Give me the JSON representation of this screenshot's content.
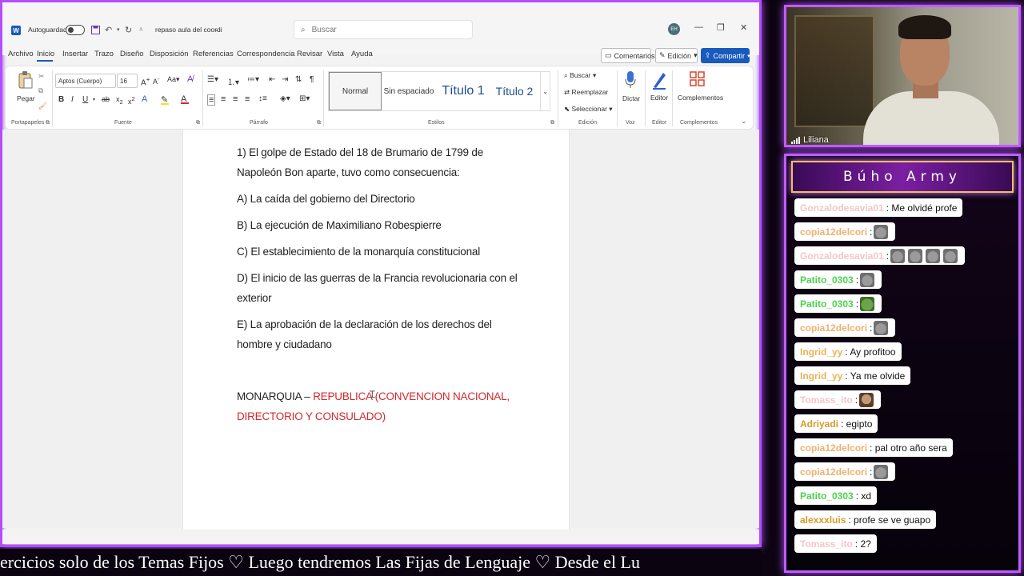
{
  "word": {
    "autosave_label": "Autoguardado",
    "doc_title": "repaso aula del coordi",
    "search_placeholder": "Buscar",
    "avatar_initials": "EH",
    "menu_tabs": [
      "Archivo",
      "Inicio",
      "Insertar",
      "Trazo",
      "Diseño",
      "Disposición",
      "Referencias",
      "Correspondencia",
      "Revisar",
      "Vista",
      "Ayuda"
    ],
    "active_tab": "Inicio",
    "comments_label": "Comentarios",
    "editing_label": "Edición",
    "share_label": "Compartir",
    "ribbon": {
      "paste_label": "Pegar",
      "clipboard_group": "Portapapeles",
      "font_name": "Aptos (Cuerpo)",
      "font_size": "16",
      "font_group": "Fuente",
      "paragraph_group": "Párrafo",
      "styles": [
        "Normal",
        "Sin espaciado",
        "Título 1",
        "Título 2"
      ],
      "styles_group": "Estilos",
      "find_label": "Buscar",
      "replace_label": "Reemplazar",
      "select_label": "Seleccionar",
      "editing_group": "Edición",
      "dictate_label": "Dictar",
      "voice_group": "Voz",
      "editor_label": "Editor",
      "editor_group": "Editor",
      "addins_label": "Complementos",
      "addins_group": "Complementos"
    },
    "document": {
      "q1_line1": "1) El golpe de Estado del 18 de Brumario de 1799 de",
      "q1_line2": "Napoleón Bon aparte, tuvo como consecuencia:",
      "opt_a": "A) La caída del gobierno del Directorio",
      "opt_b": "B) La ejecución de Maximiliano Robespierre",
      "opt_c": "C) El establecimiento de la monarquía constitucional",
      "opt_d_line1": "D) El inicio de las guerras de la Francia revolucionaria con el",
      "opt_d_line2": "exterior",
      "opt_e_line1": "E) La aprobación de la declaración de los derechos del",
      "opt_e_line2": "hombre y ciudadano",
      "note_black": "MONARQUIA – ",
      "note_red_line1": "REPUBLICA (CONVENCION NACIONAL,",
      "note_red_line2": "DIRECTORIO Y CONSULADO)"
    }
  },
  "ticker_text": "ercicios solo de los Temas Fijos   ♡   Luego tendremos Las Fijas de Lenguaje   ♡   Desde el Lu",
  "webcam": {
    "name": "Liliana"
  },
  "chat": {
    "title": "Búho Army",
    "messages": [
      {
        "user": "Gonzalodesavia01",
        "color": "#f4c6c6",
        "text": ": Me olvidé profe",
        "emotes": []
      },
      {
        "user": "copia12delcori",
        "color": "#f0b070",
        "text": ":",
        "emotes": [
          "cat"
        ]
      },
      {
        "user": "Gonzalodesavia01",
        "color": "#f4c6c6",
        "text": ":",
        "emotes": [
          "cat",
          "cat",
          "cat",
          "cat"
        ]
      },
      {
        "user": "Patito_0303",
        "color": "#4cd14c",
        "text": ":",
        "emotes": [
          "cat"
        ]
      },
      {
        "user": "Patito_0303",
        "color": "#4cd14c",
        "text": ":",
        "emotes": [
          "frog"
        ]
      },
      {
        "user": "copia12delcori",
        "color": "#f0b070",
        "text": ":",
        "emotes": [
          "cat"
        ]
      },
      {
        "user": "Ingrid_yy",
        "color": "#e8b35a",
        "text": ": Ay profitoo",
        "emotes": []
      },
      {
        "user": "Ingrid_yy",
        "color": "#e8b35a",
        "text": ": Ya me olvide",
        "emotes": []
      },
      {
        "user": "Tomass_ito",
        "color": "#f4c6c6",
        "text": ":",
        "emotes": [
          "face"
        ]
      },
      {
        "user": "Adriyadi",
        "color": "#d49a2a",
        "text": ": egipto",
        "emotes": []
      },
      {
        "user": "copia12delcori",
        "color": "#f0b070",
        "text": ": pal otro año sera",
        "emotes": []
      },
      {
        "user": "copia12delcori",
        "color": "#f0b070",
        "text": ":",
        "emotes": [
          "cat"
        ]
      },
      {
        "user": "Patito_0303",
        "color": "#4cd14c",
        "text": ": xd",
        "emotes": []
      },
      {
        "user": "alexxxluis",
        "color": "#d49a2a",
        "text": ": profe se ve guapo",
        "emotes": []
      },
      {
        "user": "Tomass_ito",
        "color": "#f4c6c6",
        "text": ": 2?",
        "emotes": []
      }
    ]
  }
}
